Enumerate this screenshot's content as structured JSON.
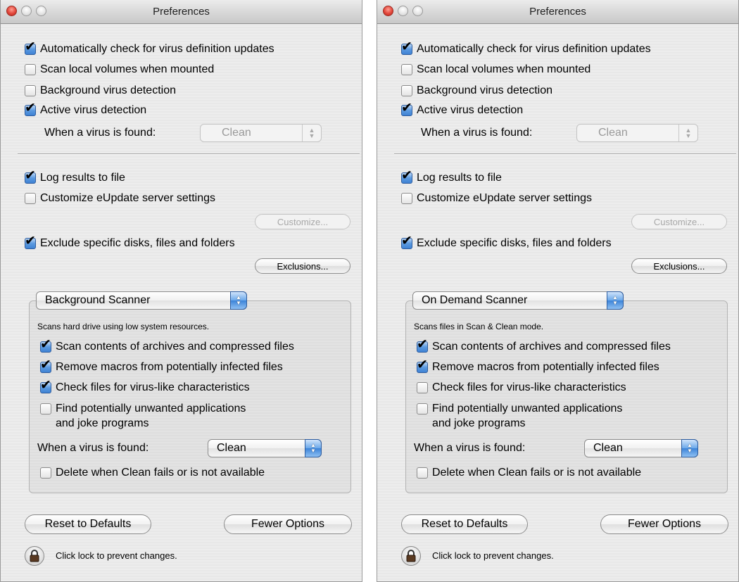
{
  "windows": [
    {
      "title": "Preferences",
      "general": [
        {
          "label": "Automatically check for virus definition updates",
          "checked": true
        },
        {
          "label": "Scan local volumes when mounted",
          "checked": false
        },
        {
          "label": "Background virus detection",
          "checked": false
        },
        {
          "label": "Active virus detection",
          "checked": true
        }
      ],
      "when_found_label": "When a virus is found:",
      "when_found_value": "Clean",
      "log_results": {
        "label": "Log results to file",
        "checked": true
      },
      "customize_eupdate": {
        "label": "Customize eUpdate server settings",
        "checked": false
      },
      "customize_button": "Customize...",
      "exclude": {
        "label": "Exclude specific disks, files and folders",
        "checked": true
      },
      "exclusions_button": "Exclusions...",
      "scanner_popup": "Background Scanner",
      "scanner_description": "Scans hard drive using low system resources.",
      "scanner_options": [
        {
          "label": "Scan contents of archives and compressed files",
          "checked": true
        },
        {
          "label": "Remove macros from potentially infected files",
          "checked": true
        },
        {
          "label": "Check files for virus-like characteristics",
          "checked": true
        },
        {
          "label": "Find potentially unwanted applications",
          "label2": "and joke programs",
          "checked": false
        }
      ],
      "scanner_when_found_label": "When a virus is found:",
      "scanner_when_found_value": "Clean",
      "delete_option": {
        "label": "Delete when Clean fails or is not available",
        "checked": false
      },
      "reset_button": "Reset to Defaults",
      "fewer_button": "Fewer Options",
      "lock_text": "Click lock to prevent changes."
    },
    {
      "title": "Preferences",
      "general": [
        {
          "label": "Automatically check for virus definition updates",
          "checked": true
        },
        {
          "label": "Scan local volumes when mounted",
          "checked": false
        },
        {
          "label": "Background virus detection",
          "checked": false
        },
        {
          "label": "Active virus detection",
          "checked": true
        }
      ],
      "when_found_label": "When a virus is found:",
      "when_found_value": "Clean",
      "log_results": {
        "label": "Log results to file",
        "checked": true
      },
      "customize_eupdate": {
        "label": "Customize eUpdate server settings",
        "checked": false
      },
      "customize_button": "Customize...",
      "exclude": {
        "label": "Exclude specific disks, files and folders",
        "checked": true
      },
      "exclusions_button": "Exclusions...",
      "scanner_popup": "On Demand Scanner",
      "scanner_description": "Scans files in Scan & Clean mode.",
      "scanner_options": [
        {
          "label": "Scan contents of archives and compressed files",
          "checked": true
        },
        {
          "label": "Remove macros from potentially infected files",
          "checked": true
        },
        {
          "label": "Check files for virus-like characteristics",
          "checked": false
        },
        {
          "label": "Find potentially unwanted applications",
          "label2": "and joke programs",
          "checked": false
        }
      ],
      "scanner_when_found_label": "When a virus is found:",
      "scanner_when_found_value": "Clean",
      "delete_option": {
        "label": "Delete when Clean fails or is not available",
        "checked": false
      },
      "reset_button": "Reset to Defaults",
      "fewer_button": "Fewer Options",
      "lock_text": "Click lock to prevent changes."
    }
  ]
}
